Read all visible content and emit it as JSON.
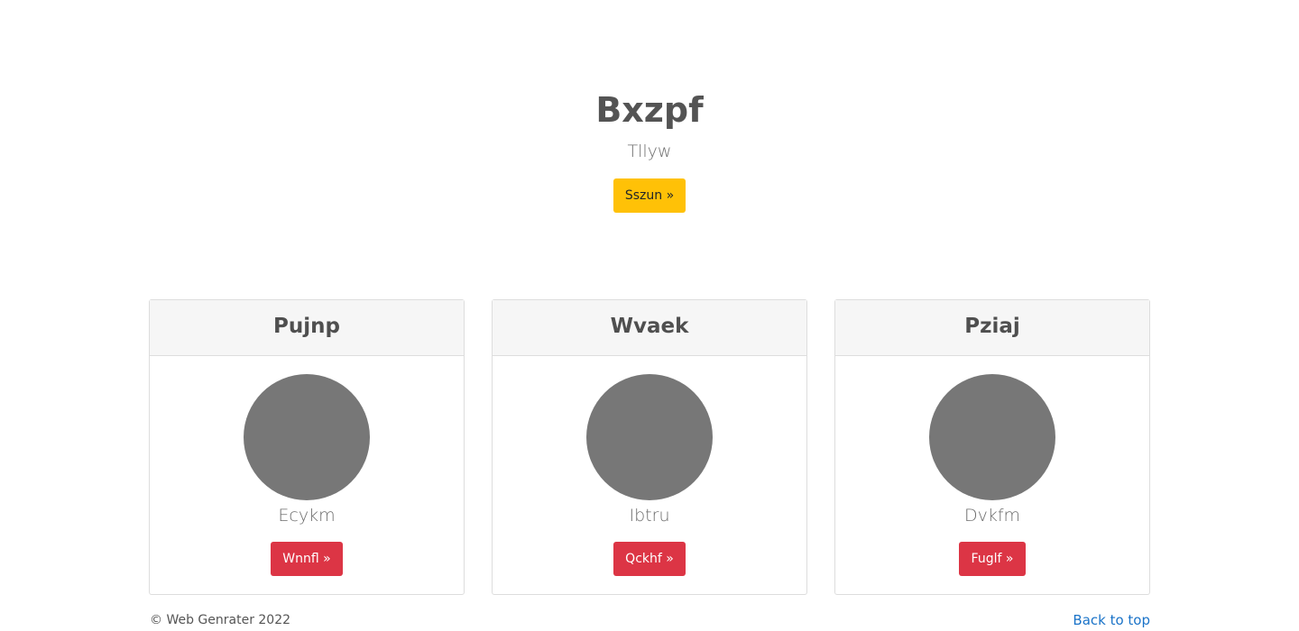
{
  "hero": {
    "title": "Bxzpf",
    "subtitle": "Tllyw",
    "button_label": "Sszun »"
  },
  "cards": [
    {
      "title": "Pujnp",
      "label": "Ecykm",
      "button_label": "Wnnfl »"
    },
    {
      "title": "Wvaek",
      "label": "Ibtru",
      "button_label": "Qckhf »"
    },
    {
      "title": "Pziaj",
      "label": "Dvkfm",
      "button_label": "Fuglf »"
    }
  ],
  "footer": {
    "copyright": "© Web Genrater 2022",
    "back_to_top": "Back to top"
  },
  "colors": {
    "primary_button": "#ffc107",
    "danger_button": "#dc3545",
    "avatar": "#777777",
    "link": "#1a73c8"
  }
}
